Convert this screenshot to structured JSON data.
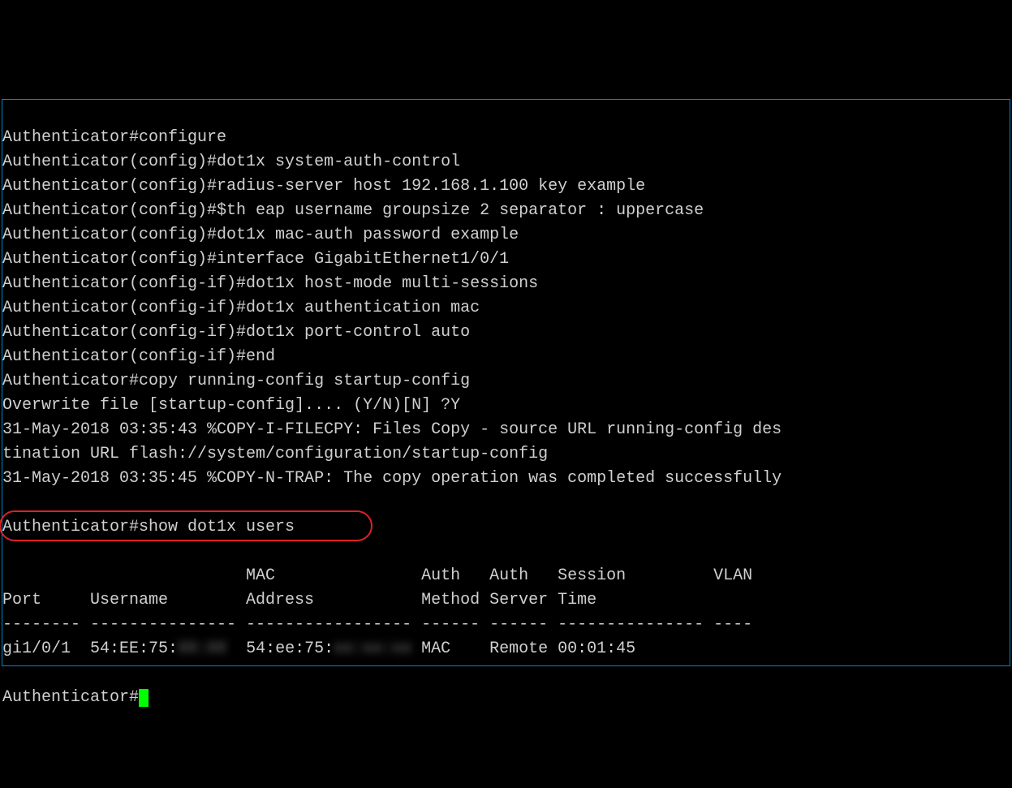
{
  "terminal": {
    "lines": [
      "Authenticator#configure",
      "Authenticator(config)#dot1x system-auth-control",
      "Authenticator(config)#radius-server host 192.168.1.100 key example",
      "Authenticator(config)#$th eap username groupsize 2 separator : uppercase",
      "Authenticator(config)#dot1x mac-auth password example",
      "Authenticator(config)#interface GigabitEthernet1/0/1",
      "Authenticator(config-if)#dot1x host-mode multi-sessions",
      "Authenticator(config-if)#dot1x authentication mac",
      "Authenticator(config-if)#dot1x port-control auto",
      "Authenticator(config-if)#end",
      "Authenticator#copy running-config startup-config",
      "Overwrite file [startup-config].... (Y/N)[N] ?Y",
      "31-May-2018 03:35:43 %COPY-I-FILECPY: Files Copy - source URL running-config des",
      "tination URL flash://system/configuration/startup-config",
      "31-May-2018 03:35:45 %COPY-N-TRAP: The copy operation was completed successfully"
    ],
    "highlighted_command": "Authenticator#show dot1x users",
    "table": {
      "header1": "                         MAC               Auth   Auth   Session         VLAN",
      "header2": "Port     Username        Address           Method Server Time",
      "divider": "-------- --------------- ----------------- ------ ------ --------------- ----",
      "row_port": "gi1/0/1  ",
      "row_username_prefix": "54:EE:75:",
      "row_username_redacted": "XX:XX",
      "row_mac_prefix": "  54:ee:75:",
      "row_mac_redacted": "xx:xx:xx",
      "row_rest": " MAC    Remote 00:01:45"
    },
    "final_prompt": "Authenticator#"
  }
}
